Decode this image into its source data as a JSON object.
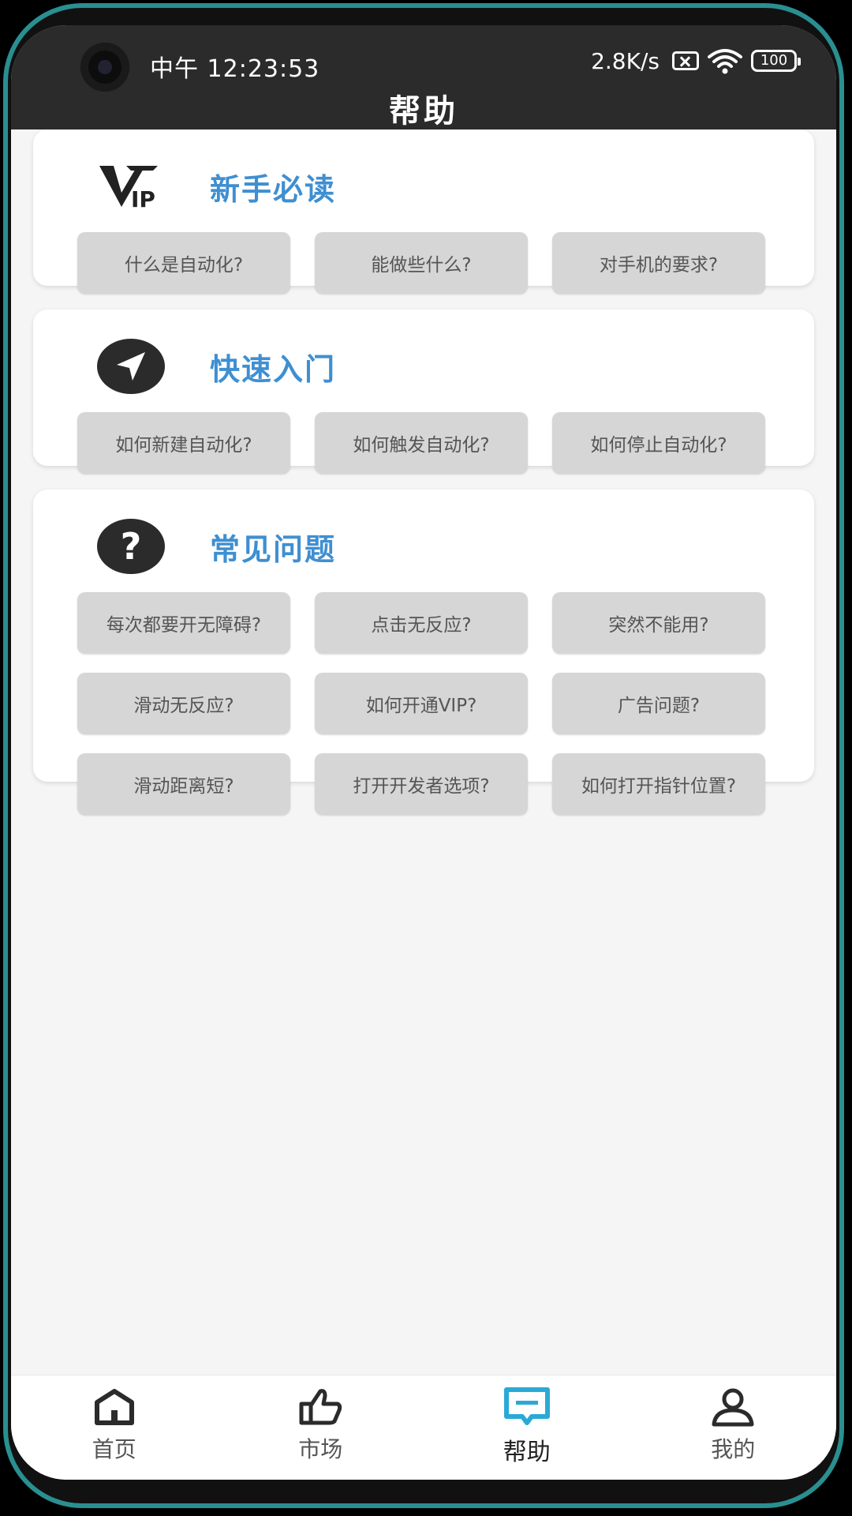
{
  "status_bar": {
    "time": "中午 12:23:53",
    "net_speed": "2.8K/s",
    "battery": "100"
  },
  "header": {
    "title": "帮助"
  },
  "sections": [
    {
      "title": "新手必读",
      "icon": "vip-icon",
      "items": [
        "什么是自动化?",
        "能做些什么?",
        "对手机的要求?"
      ]
    },
    {
      "title": "快速入门",
      "icon": "navigation-arrow-icon",
      "items": [
        "如何新建自动化?",
        "如何触发自动化?",
        "如何停止自动化?"
      ]
    },
    {
      "title": "常见问题",
      "icon": "question-mark-icon",
      "items": [
        "每次都要开无障碍?",
        "点击无反应?",
        "突然不能用?",
        "滑动无反应?",
        "如何开通VIP?",
        "广告问题?",
        "滑动距离短?",
        "打开开发者选项?",
        "如何打开指针位置?"
      ]
    }
  ],
  "vip_icon_text": "VIP",
  "nav": [
    {
      "label": "首页",
      "icon": "home-icon"
    },
    {
      "label": "市场",
      "icon": "thumbs-up-icon"
    },
    {
      "label": "帮助",
      "icon": "help-chat-icon",
      "active": true
    },
    {
      "label": "我的",
      "icon": "user-icon"
    }
  ],
  "colors": {
    "accent": "#3f8fd1",
    "topbar": "#2b2b2b",
    "button_bg": "#d6d6d6",
    "frame": "#2a8f90"
  }
}
